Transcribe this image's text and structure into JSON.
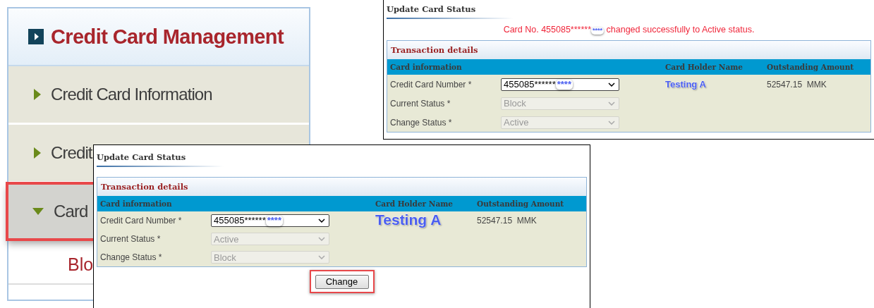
{
  "sidebar": {
    "title": "Credit Card Management",
    "items": [
      {
        "label": "Credit Card Information",
        "expanded": false,
        "highlighted": false
      },
      {
        "label": "Credit",
        "expanded": false,
        "highlighted": false
      },
      {
        "label": "Card",
        "expanded": true,
        "highlighted": true,
        "children": [
          {
            "label": "Blo"
          }
        ]
      }
    ]
  },
  "windows": [
    {
      "title": "Update Card Status",
      "message": {
        "before": "Card No. 455085******",
        "masked": "****",
        "after": " changed successfully to Active status."
      },
      "section": "Transaction details",
      "columns": [
        "Card information",
        "Card Holder Name",
        "Outstanding Amount"
      ],
      "fields": [
        {
          "label": "Credit Card Number  *",
          "value": "455085******",
          "masked": "****",
          "disabled": false
        },
        {
          "label": "Current Status *",
          "value": "Block",
          "disabled": true
        },
        {
          "label": "Change Status *",
          "value": "Active",
          "disabled": true
        }
      ],
      "holder": "Testing A",
      "amount": "52547.15  MMK"
    },
    {
      "title": "Update Card Status",
      "section": "Transaction details",
      "columns": [
        "Card information",
        "Card Holder Name",
        "Outstanding Amount"
      ],
      "fields": [
        {
          "label": "Credit Card Number  *",
          "value": "455085******",
          "masked": "****",
          "disabled": false
        },
        {
          "label": "Current Status *",
          "value": "Active",
          "disabled": true
        },
        {
          "label": "Change Status *",
          "value": "Block",
          "disabled": true
        }
      ],
      "holder": "Testing A",
      "amount": "52547.15  MMK",
      "button": {
        "label": "Change",
        "highlighted": true
      }
    }
  ]
}
